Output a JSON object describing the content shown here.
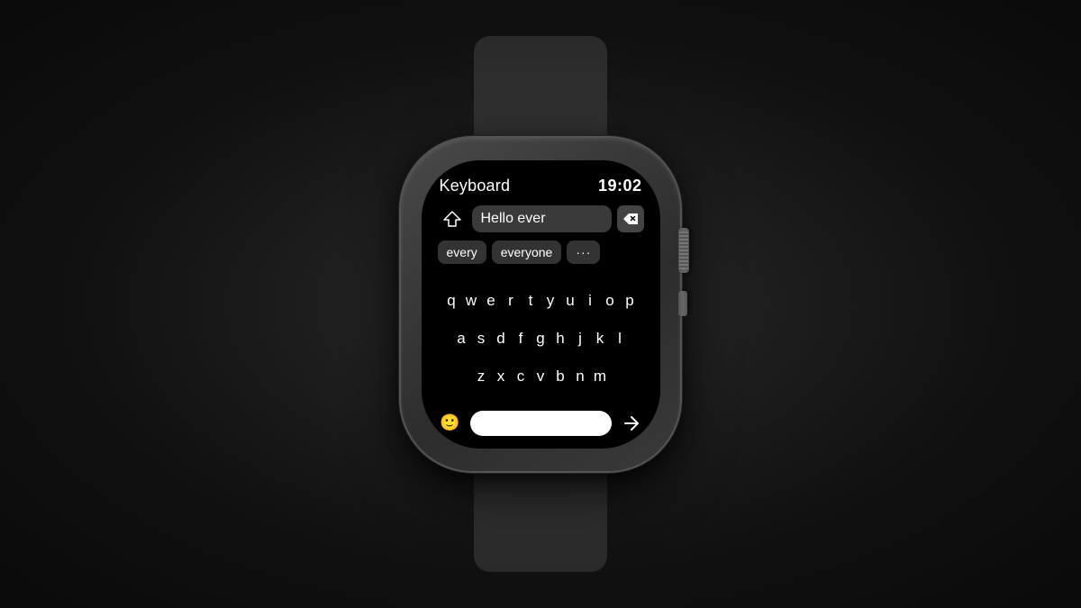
{
  "scene": {
    "background_color": "#1a1a1a"
  },
  "watch": {
    "title": "Keyboard",
    "time": "19:02",
    "input_text": "Hello ever",
    "suggestions": [
      {
        "label": "every"
      },
      {
        "label": "everyone"
      },
      {
        "label": "···"
      }
    ],
    "keyboard": {
      "row1": [
        "q",
        "w",
        "e",
        "r",
        "t",
        "y",
        "u",
        "i",
        "o",
        "p"
      ],
      "row2": [
        "a",
        "s",
        "d",
        "f",
        "g",
        "h",
        "j",
        "k",
        "l"
      ],
      "row3": [
        "z",
        "x",
        "c",
        "v",
        "b",
        "n",
        "m"
      ]
    },
    "emoji_icon": "🙂",
    "shift_label": "⇧",
    "backspace_label": "⌫",
    "send_label": "➤"
  }
}
